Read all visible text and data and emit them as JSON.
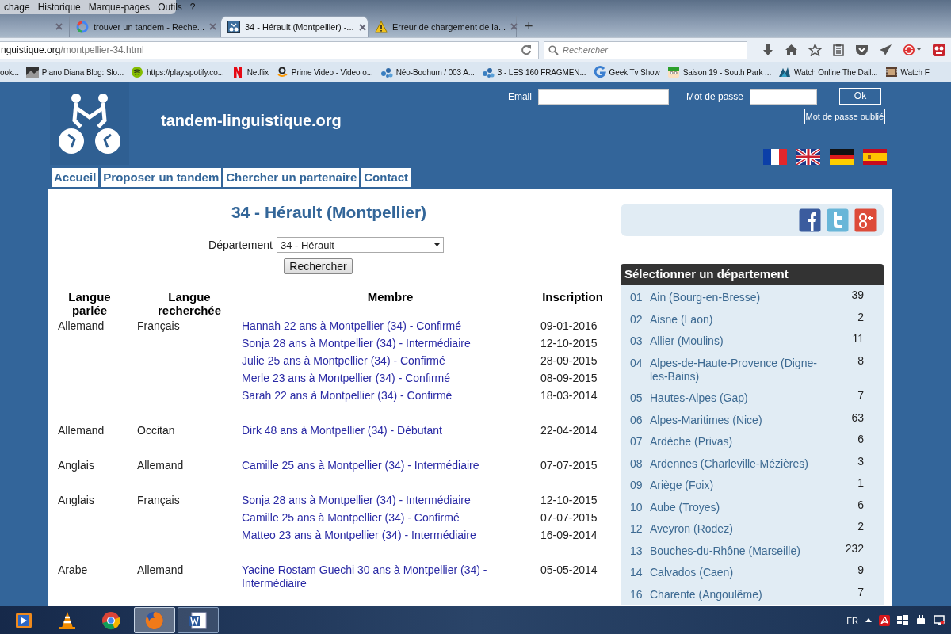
{
  "browser": {
    "menu": [
      "chage",
      "Historique",
      "Marque-pages",
      "Outils",
      "?"
    ],
    "tabs": [
      {
        "selected": false
      },
      {
        "title": "trouver un tandem - Reche...",
        "selected": false
      },
      {
        "title": "34 - Hérault (Montpellier) -...",
        "selected": true
      },
      {
        "title": "Erreur de chargement de la...",
        "selected": false
      }
    ],
    "new_tab": "+",
    "address": {
      "host": "nguistique.org",
      "path": "/montpellier-34.html"
    },
    "search": {
      "placeholder": "Rechercher"
    },
    "bookmarks": [
      "ook...",
      "Piano Diana Blog: Slo...",
      "https://play.spotify.co...",
      "Netflix",
      "Prime Video - Video o...",
      "Néo-Bodhum / 003 A...",
      "3 - LES 160 FRAGMEN...",
      "Geek Tv Show",
      "Saison 19 - South Park ...",
      "Watch Online The Dail...",
      "Watch F"
    ]
  },
  "site": {
    "title": "tandem-linguistique.org",
    "login": {
      "email_label": "Email",
      "password_label": "Mot de passe",
      "submit": "Ok",
      "forgot": "Mot de passe oublié"
    },
    "nav": [
      "Accueil",
      "Proposer un tandem",
      "Chercher un partenaire",
      "Contact"
    ]
  },
  "main": {
    "heading": "34 - Hérault (Montpellier)",
    "filter": {
      "label": "Département",
      "value": "34 - Hérault",
      "button": "Rechercher"
    },
    "table": {
      "columns": [
        "Langue parlée",
        "Langue recherchée",
        "Membre",
        "Inscription"
      ],
      "groups": [
        {
          "spoken": "Allemand",
          "sought": "Français",
          "members": [
            {
              "name": "Hannah 22 ans à Montpellier (34) - Confirmé",
              "date": "09-01-2016"
            },
            {
              "name": "Sonja 28 ans à Montpellier (34) - Intermédiaire",
              "date": "12-10-2015"
            },
            {
              "name": "Julie 25 ans à Montpellier (34) - Confirmé",
              "date": "28-09-2015"
            },
            {
              "name": "Merle 23 ans à Montpellier (34) - Confirmé",
              "date": "08-09-2015"
            },
            {
              "name": "Sarah 22 ans à Montpellier (34) - Confirmé",
              "date": "18-03-2014"
            }
          ]
        },
        {
          "spoken": "Allemand",
          "sought": "Occitan",
          "members": [
            {
              "name": "Dirk 48 ans à Montpellier (34) - Débutant",
              "date": "22-04-2014"
            }
          ]
        },
        {
          "spoken": "Anglais",
          "sought": "Allemand",
          "members": [
            {
              "name": "Camille 25 ans à Montpellier (34) - Intermédiaire",
              "date": "07-07-2015"
            }
          ]
        },
        {
          "spoken": "Anglais",
          "sought": "Français",
          "members": [
            {
              "name": "Sonja 28 ans à Montpellier (34) - Intermédiaire",
              "date": "12-10-2015"
            },
            {
              "name": "Camille 25 ans à Montpellier (34) - Confirmé",
              "date": "07-07-2015"
            },
            {
              "name": "Matteo 23 ans à Montpellier (34) - Intermédiaire",
              "date": "16-09-2014"
            }
          ]
        },
        {
          "spoken": "Arabe",
          "sought": "Allemand",
          "members": [
            {
              "name": "Yacine Rostam Guechi 30 ans à Montpellier (34) - Intermédiaire",
              "date": "05-05-2014"
            }
          ]
        }
      ]
    }
  },
  "sidebar": {
    "title": "Sélectionner un département",
    "departments": [
      {
        "code": "01",
        "name": "Ain (Bourg-en-Bresse)",
        "count": "39"
      },
      {
        "code": "02",
        "name": "Aisne (Laon)",
        "count": "2"
      },
      {
        "code": "03",
        "name": "Allier (Moulins)",
        "count": "11"
      },
      {
        "code": "04",
        "name": "Alpes-de-Haute-Provence (Digne-les-Bains)",
        "count": "8"
      },
      {
        "code": "05",
        "name": "Hautes-Alpes (Gap)",
        "count": "7"
      },
      {
        "code": "06",
        "name": "Alpes-Maritimes (Nice)",
        "count": "63"
      },
      {
        "code": "07",
        "name": "Ardèche (Privas)",
        "count": "6"
      },
      {
        "code": "08",
        "name": "Ardennes (Charleville-Mézières)",
        "count": "3"
      },
      {
        "code": "09",
        "name": "Ariège (Foix)",
        "count": "1"
      },
      {
        "code": "10",
        "name": "Aube (Troyes)",
        "count": "6"
      },
      {
        "code": "12",
        "name": "Aveyron (Rodez)",
        "count": "2"
      },
      {
        "code": "13",
        "name": "Bouches-du-Rhône (Marseille)",
        "count": "232"
      },
      {
        "code": "14",
        "name": "Calvados (Caen)",
        "count": "9"
      },
      {
        "code": "16",
        "name": "Charente (Angoulême)",
        "count": "7"
      }
    ]
  },
  "taskbar": {
    "apps": [
      {
        "open": false,
        "selected": false
      },
      {
        "open": false,
        "selected": false
      },
      {
        "open": false,
        "selected": false
      },
      {
        "open": true,
        "selected": true
      },
      {
        "open": true,
        "selected": false
      }
    ],
    "language": "FR"
  }
}
